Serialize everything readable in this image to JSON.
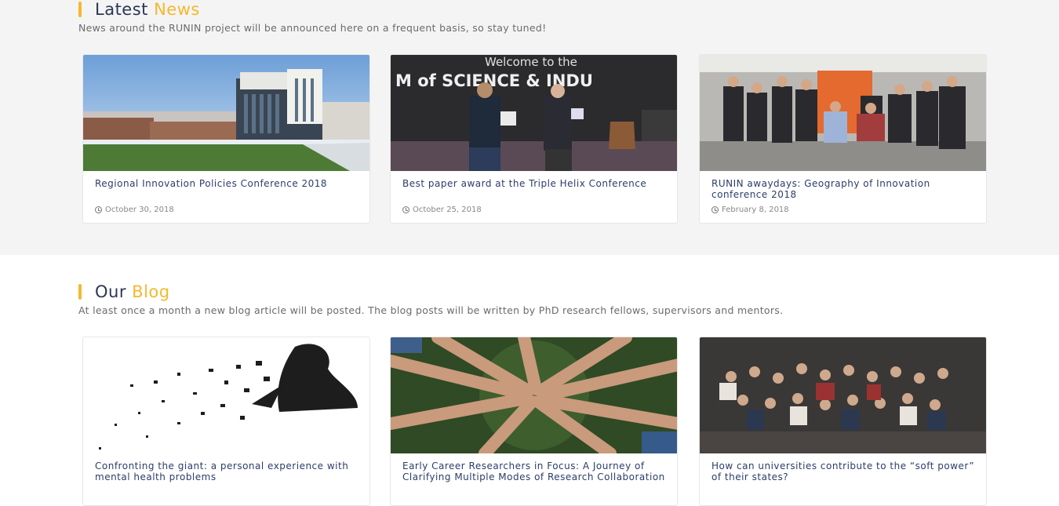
{
  "news": {
    "heading_plain": "Latest",
    "heading_accent": "News",
    "subtitle": "News around the RUNIN project will be announced here on a frequent basis, so stay tuned!",
    "items": [
      {
        "title": "Regional Innovation Policies Conference 2018",
        "date": "October 30, 2018"
      },
      {
        "title": "Best paper award at the Triple Helix Conference",
        "date": "October 25, 2018"
      },
      {
        "title": "RUNIN awaydays: Geography of Innovation conference 2018",
        "date": "February 8, 2018"
      }
    ],
    "banner_text": "Welcome to the",
    "banner_text_2": "M  of SCIENCE & INDU"
  },
  "blog": {
    "heading_plain": "Our",
    "heading_accent": "Blog",
    "subtitle": "At least once a month a new blog article will be posted. The blog posts will be written by PhD research fellows, supervisors and mentors.",
    "items": [
      {
        "title": "Confronting the giant: a personal experience with mental health problems"
      },
      {
        "title": "Early Career Researchers in Focus: A Journey of Clarifying Multiple Modes of Research Collaboration"
      },
      {
        "title": "How can universities contribute to the “soft power” of their states?"
      }
    ]
  },
  "colors": {
    "accent": "#f5b82e",
    "heading": "#2c3656",
    "link": "#2c3d6b"
  },
  "icons": {
    "date": "clock-icon"
  }
}
